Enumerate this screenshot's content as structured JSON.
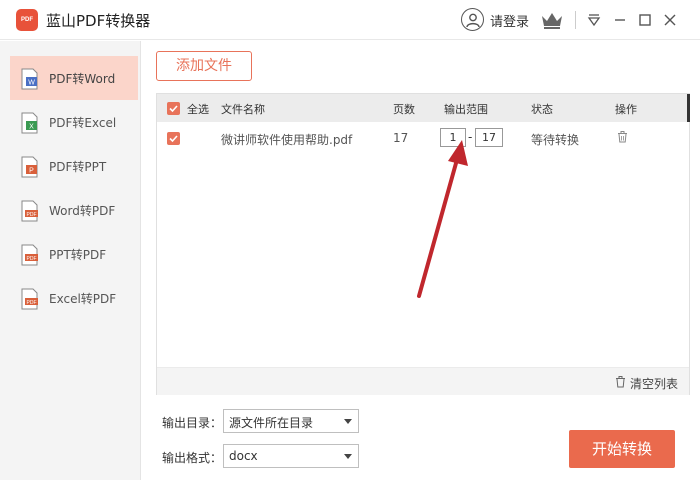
{
  "titlebar": {
    "logo_text": "PDF",
    "app_title": "蓝山PDF转换器",
    "login_label": "请登录"
  },
  "sidebar": {
    "items": [
      {
        "label": "PDF转Word",
        "active": true,
        "icon": "word-doc-icon",
        "badge_color": "#4a6fc4"
      },
      {
        "label": "PDF转Excel",
        "active": false,
        "icon": "excel-doc-icon",
        "badge_color": "#3a9a52"
      },
      {
        "label": "PDF转PPT",
        "active": false,
        "icon": "ppt-doc-icon",
        "badge_color": "#d9603b"
      },
      {
        "label": "Word转PDF",
        "active": false,
        "icon": "pdf-doc-icon",
        "badge_color": "#d9603b"
      },
      {
        "label": "PPT转PDF",
        "active": false,
        "icon": "pdf-doc-icon",
        "badge_color": "#d9603b"
      },
      {
        "label": "Excel转PDF",
        "active": false,
        "icon": "pdf-doc-icon",
        "badge_color": "#d9603b"
      }
    ]
  },
  "toolbar": {
    "add_file_label": "添加文件"
  },
  "table": {
    "headers": {
      "select_all": "全选",
      "file_name": "文件名称",
      "pages": "页数",
      "output_range": "输出范围",
      "status": "状态",
      "actions": "操作"
    },
    "rows": [
      {
        "checked": true,
        "file_name": "微讲师软件使用帮助.pdf",
        "pages": "17",
        "range_start": "1",
        "range_end": "17",
        "status": "等待转换"
      }
    ],
    "clear_list_label": "清空列表"
  },
  "form": {
    "output_dir_label": "输出目录：",
    "output_dir_value": "源文件所在目录",
    "output_format_label": "输出格式：",
    "output_format_value": "docx"
  },
  "start_button_label": "开始转换",
  "colors": {
    "accent": "#e8735a",
    "active_sidebar": "#fbd5ca",
    "start_button": "#ea6a4d",
    "annotation_arrow": "#c0272d"
  }
}
